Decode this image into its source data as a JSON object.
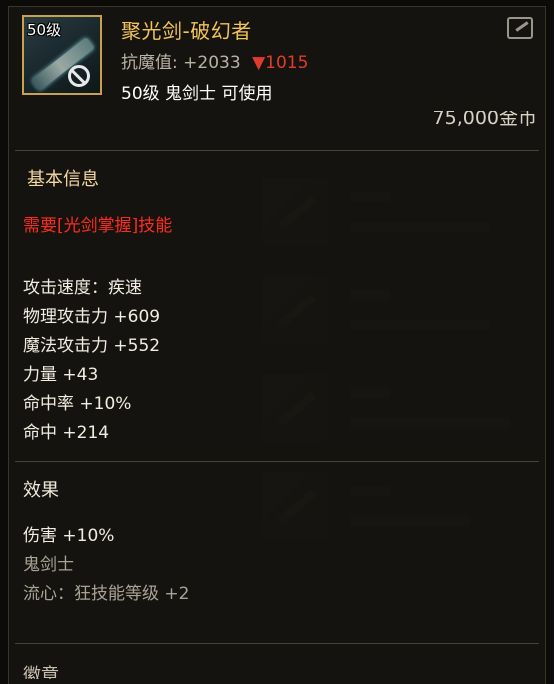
{
  "item": {
    "level_badge": "50级",
    "name": "聚光剑-破幻者",
    "resist_label": "抗魔值:",
    "resist_value": "+2033",
    "resist_delta": "▼1015",
    "requirement": "50级 鬼剑士 可使用",
    "price": "75,000金币"
  },
  "basic_info": {
    "title": "基本信息",
    "skill_requirement": "需要[光剑掌握]技能",
    "stats": [
      "攻击速度：疾速",
      "物理攻击力 +609",
      "魔法攻击力 +552",
      "力量 +43",
      "命中率 +10%",
      "命中 +214"
    ]
  },
  "effects": {
    "title": "效果",
    "lines": [
      "伤害 +10%",
      "鬼剑士",
      "流心：狂技能等级 +2"
    ]
  },
  "next_section": {
    "title": "徽章"
  },
  "colors": {
    "item_name": "#f2c45a",
    "red_requirement": "#ff2a1e",
    "section_title": "#f3d9a2",
    "icon_border": "#c8a24a"
  },
  "icons": {
    "share": "share-out-icon",
    "unusable": "ban-icon"
  }
}
